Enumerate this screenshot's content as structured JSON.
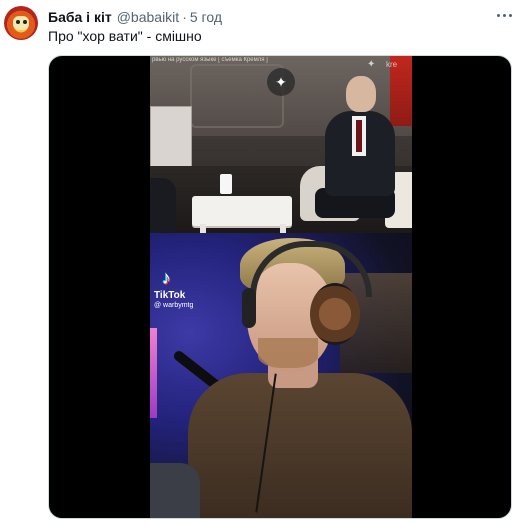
{
  "tweet": {
    "display_name": "Баба і кіт",
    "handle": "@babaikit",
    "separator": "·",
    "time": "5 год",
    "text": "Про \"хор вати\" - смішно"
  },
  "media": {
    "top_caption": "рвью на русском языке [ съемка Кремля ]",
    "watermark_top": "kre",
    "tiktok_brand": "TikTok",
    "tiktok_handle": "@ warbymtg"
  },
  "icons": {
    "more": "more-horizontal-icon",
    "sparkle": "sparkle-icon",
    "tiktok": "tiktok-icon",
    "emblem": "eagle-emblem-icon"
  },
  "colors": {
    "text_primary": "#0f1419",
    "text_secondary": "#536471",
    "media_border": "#cfd9de"
  }
}
